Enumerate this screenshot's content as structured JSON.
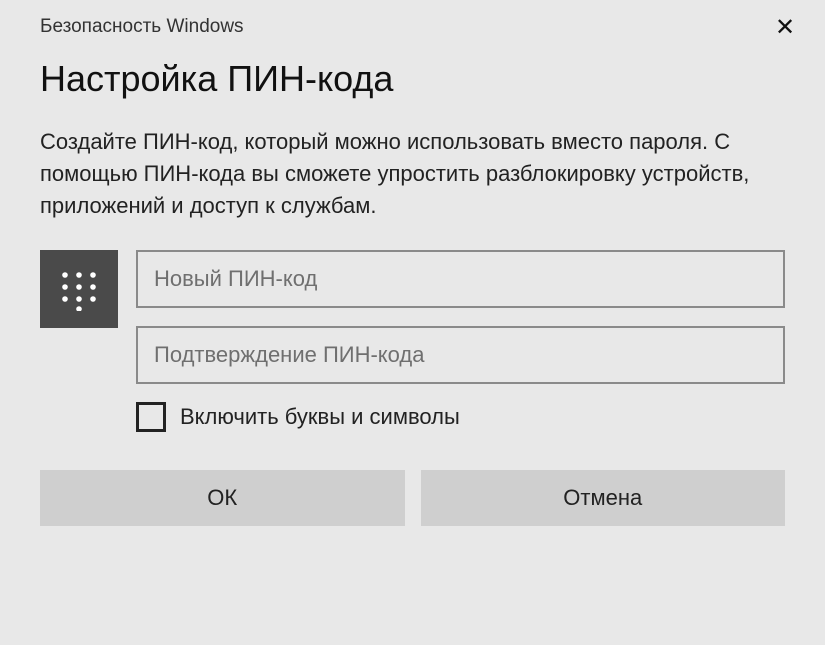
{
  "titlebar": {
    "title": "Безопасность Windows",
    "close_glyph": "✕"
  },
  "dialog": {
    "heading": "Настройка ПИН-кода",
    "description": "Создайте ПИН-код, который можно использовать вместо пароля. С помощью ПИН-кода вы сможете упростить разблокировку устройств, приложений и доступ к службам.",
    "inputs": {
      "new_pin_placeholder": "Новый ПИН-код",
      "confirm_pin_placeholder": "Подтверждение ПИН-кода"
    },
    "checkbox": {
      "label": "Включить буквы и символы",
      "checked": false
    },
    "buttons": {
      "ok": "ОК",
      "cancel": "Отмена"
    },
    "icon_name": "keypad-icon"
  }
}
